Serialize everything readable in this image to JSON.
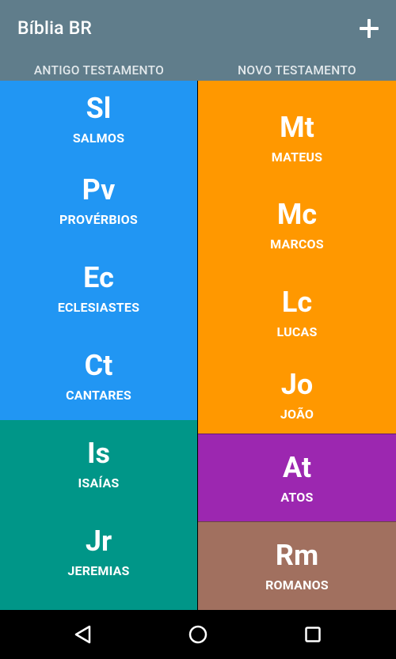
{
  "toolbar": {
    "title": "Bíblia BR",
    "add_icon": "plus-icon"
  },
  "tabs": [
    {
      "label": "ANTIGO TESTAMENTO"
    },
    {
      "label": "NOVO TESTAMENTO"
    }
  ],
  "old_testament": [
    {
      "abbr": "Sl",
      "name": "SALMOS",
      "color": "#2196F3"
    },
    {
      "abbr": "Pv",
      "name": "PROVÉRBIOS",
      "color": "#2196F3"
    },
    {
      "abbr": "Ec",
      "name": "ECLESIASTES",
      "color": "#2196F3"
    },
    {
      "abbr": "Ct",
      "name": "CANTARES",
      "color": "#2196F3"
    },
    {
      "abbr": "Is",
      "name": "ISAÍAS",
      "color": "#009688"
    },
    {
      "abbr": "Jr",
      "name": "JEREMIAS",
      "color": "#009688"
    }
  ],
  "new_testament": [
    {
      "abbr": "Mt",
      "name": "MATEUS",
      "color": "#FF9800"
    },
    {
      "abbr": "Mc",
      "name": "MARCOS",
      "color": "#FF9800"
    },
    {
      "abbr": "Lc",
      "name": "LUCAS",
      "color": "#FF9800"
    },
    {
      "abbr": "Jo",
      "name": "JOÃO",
      "color": "#FF9800"
    },
    {
      "abbr": "At",
      "name": "ATOS",
      "color": "#9C27B0"
    },
    {
      "abbr": "Rm",
      "name": "ROMANOS",
      "color": "#A1705F"
    }
  ],
  "navbar": {
    "back_icon": "back-triangle-icon",
    "home_icon": "home-circle-icon",
    "recents_icon": "recents-square-icon"
  }
}
